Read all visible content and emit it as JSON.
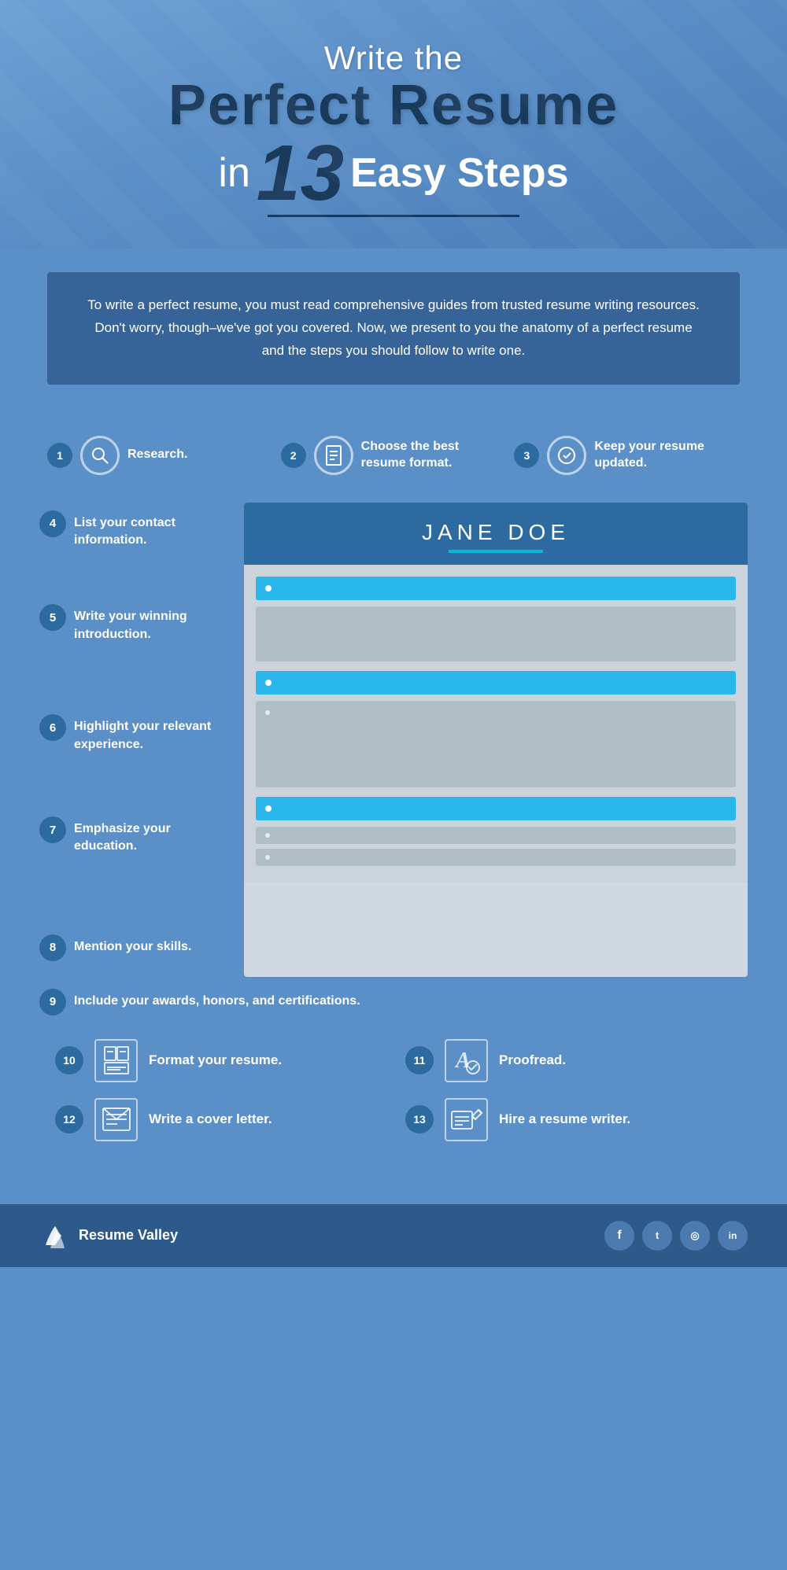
{
  "header": {
    "line1": "Write the",
    "line2": "Perfect Resume",
    "line3_in": "in",
    "line3_num": "13",
    "line3_easy": "Easy Steps"
  },
  "intro": {
    "text": "To write a perfect resume, you must read comprehensive guides from trusted resume writing resources. Don't worry, though–we've got you covered. Now, we present to you the anatomy of a perfect resume and the steps you should follow to write one."
  },
  "top_steps": [
    {
      "number": "1",
      "label": "Research."
    },
    {
      "number": "2",
      "label": "Choose the best resume format."
    },
    {
      "number": "3",
      "label": "Keep your resume updated."
    }
  ],
  "left_steps": [
    {
      "number": "4",
      "label": "List your contact information."
    },
    {
      "number": "5",
      "label": "Write your winning introduction."
    },
    {
      "number": "6",
      "label": "Highlight your relevant experience."
    },
    {
      "number": "7",
      "label": "Emphasize your education."
    },
    {
      "number": "8",
      "label": "Mention your skills."
    }
  ],
  "step9": {
    "number": "9",
    "label": "Include your awards, honors, and certifications."
  },
  "resume_mock": {
    "name": "JANE DOE"
  },
  "bottom_steps": [
    {
      "number": "10",
      "label": "Format your resume."
    },
    {
      "number": "11",
      "label": "Proofread."
    },
    {
      "number": "12",
      "label": "Write a cover letter."
    },
    {
      "number": "13",
      "label": "Hire a resume writer."
    }
  ],
  "footer": {
    "brand": "Resume Valley",
    "social": [
      "f",
      "t",
      "✦",
      "in"
    ]
  }
}
